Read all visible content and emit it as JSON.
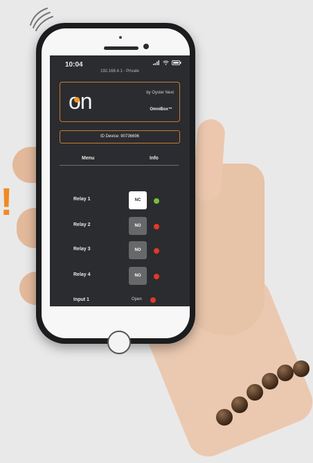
{
  "screen": {
    "time": "10:04",
    "url": "192.168.4.1 - Private",
    "brand": {
      "logo": "on",
      "by": "by Oyster Next",
      "product": "OmniBox™"
    },
    "device_id": "ID Device: 90736696",
    "nav": {
      "menu": "Menu",
      "info": "Info"
    },
    "relays": [
      {
        "label": "Relay 1",
        "button": "NC",
        "status_color": "#78bf3a"
      },
      {
        "label": "Relay 2",
        "button": "NO",
        "status_color": "#e2372b"
      },
      {
        "label": "Relay 3",
        "button": "NO",
        "status_color": "#e2372b"
      },
      {
        "label": "Relay 4",
        "button": "NO",
        "status_color": "#e2372b"
      }
    ],
    "input": {
      "label": "Input 1",
      "status": "Open",
      "status_color": "#e2372b"
    }
  },
  "colors": {
    "screen_bg": "#2b2c2f",
    "accent": "#c77b34",
    "orange": "#f39324"
  },
  "icons": [
    "signal-waves-icon",
    "wifi-icon",
    "battery-icon",
    "cellular-icon",
    "home-button-icon"
  ]
}
